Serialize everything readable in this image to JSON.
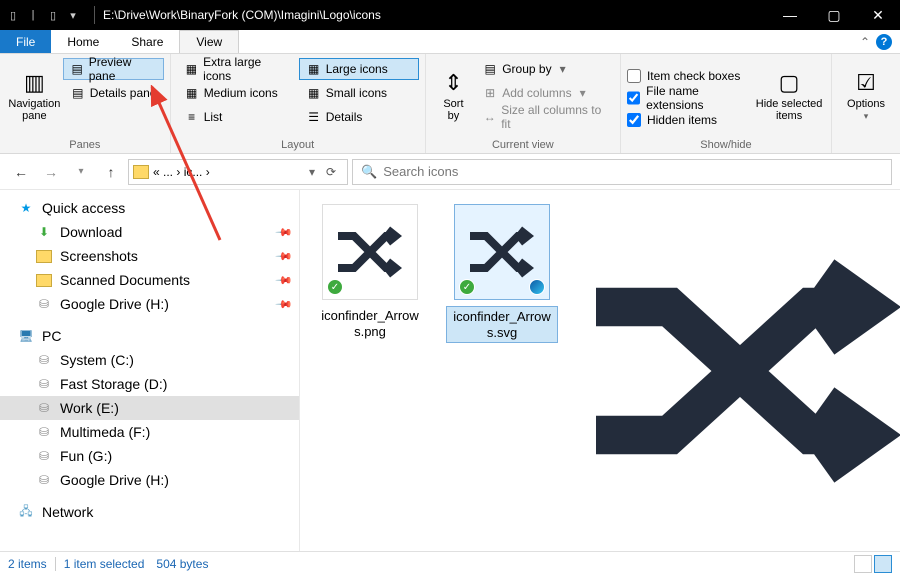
{
  "titlebar": {
    "path": "E:\\Drive\\Work\\BinaryFork (COM)\\Imagini\\Logo\\icons"
  },
  "tabs": {
    "file": "File",
    "home": "Home",
    "share": "Share",
    "view": "View"
  },
  "ribbon": {
    "panes": {
      "nav": "Navigation\npane",
      "preview": "Preview pane",
      "details": "Details pane",
      "label": "Panes"
    },
    "layout": {
      "xl": "Extra large icons",
      "lg": "Large icons",
      "md": "Medium icons",
      "sm": "Small icons",
      "list": "List",
      "det": "Details",
      "label": "Layout"
    },
    "curview": {
      "sort": "Sort\nby",
      "group": "Group by",
      "addcols": "Add columns",
      "sizecols": "Size all columns to fit",
      "label": "Current view"
    },
    "showhide": {
      "chk_boxes": "Item check boxes",
      "chk_ext": "File name extensions",
      "chk_hidden": "Hidden items",
      "hide": "Hide selected\nitems",
      "label": "Show/hide"
    },
    "options": "Options"
  },
  "nav": {
    "breadcrumb_short": "« ...",
    "breadcrumb_last": "ic...",
    "search_placeholder": "Search icons"
  },
  "sidebar": {
    "quick_access": "Quick access",
    "items_qa": [
      {
        "label": "Download",
        "icon": "download"
      },
      {
        "label": "Screenshots",
        "icon": "folder"
      },
      {
        "label": "Scanned Documents",
        "icon": "folder"
      },
      {
        "label": "Google Drive (H:)",
        "icon": "drive"
      }
    ],
    "pc": "PC",
    "items_pc": [
      {
        "label": "System (C:)",
        "icon": "sys"
      },
      {
        "label": "Fast Storage (D:)",
        "icon": "drive"
      },
      {
        "label": "Work (E:)",
        "icon": "drive",
        "selected": true
      },
      {
        "label": "Multimeda (F:)",
        "icon": "drive"
      },
      {
        "label": "Fun (G:)",
        "icon": "drive"
      },
      {
        "label": "Google Drive (H:)",
        "icon": "drive"
      }
    ],
    "network": "Network"
  },
  "files": [
    {
      "name": "iconfinder_Arrows.png",
      "selected": false
    },
    {
      "name": "iconfinder_Arrows.svg",
      "selected": true
    }
  ],
  "status": {
    "count": "2 items",
    "selected": "1 item selected",
    "size": "504 bytes"
  }
}
